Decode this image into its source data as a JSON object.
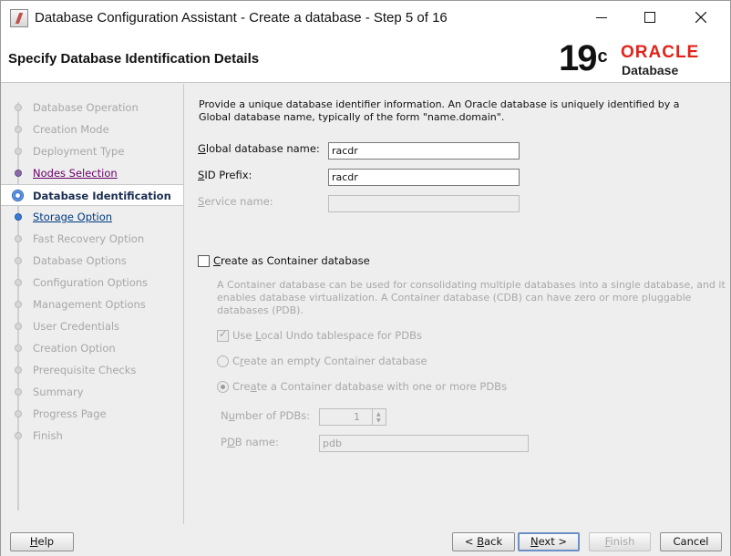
{
  "window": {
    "title": "Database Configuration Assistant - Create a database - Step 5 of 16"
  },
  "header": {
    "page_title": "Specify Database Identification Details",
    "logo_version": "19",
    "logo_version_sup": "c",
    "logo_brand": "ORACLE",
    "logo_product": "Database",
    "brand_color": "#e2231a"
  },
  "nav": {
    "items": [
      {
        "label": "Database Operation",
        "state": "disabled"
      },
      {
        "label": "Creation Mode",
        "state": "disabled"
      },
      {
        "label": "Deployment Type",
        "state": "disabled"
      },
      {
        "label": "Nodes Selection",
        "state": "visited"
      },
      {
        "label": "Database Identification",
        "state": "current"
      },
      {
        "label": "Storage Option",
        "state": "link"
      },
      {
        "label": "Fast Recovery Option",
        "state": "disabled"
      },
      {
        "label": "Database Options",
        "state": "disabled"
      },
      {
        "label": "Configuration Options",
        "state": "disabled"
      },
      {
        "label": "Management Options",
        "state": "disabled"
      },
      {
        "label": "User Credentials",
        "state": "disabled"
      },
      {
        "label": "Creation Option",
        "state": "disabled"
      },
      {
        "label": "Prerequisite Checks",
        "state": "disabled"
      },
      {
        "label": "Summary",
        "state": "disabled"
      },
      {
        "label": "Progress Page",
        "state": "disabled"
      },
      {
        "label": "Finish",
        "state": "disabled"
      }
    ]
  },
  "main": {
    "description": "Provide a unique database identifier information. An Oracle database is uniquely identified by a Global database name, typically of the form \"name.domain\".",
    "global_name": {
      "label_first": "G",
      "label_rest": "lobal database name:",
      "value": "racdr"
    },
    "sid_prefix": {
      "label_first": "S",
      "label_rest": "ID Prefix:",
      "value": "racdr"
    },
    "service_name": {
      "label_first": "S",
      "label_rest": "ervice name:",
      "value": ""
    },
    "container_checkbox": {
      "label_first": "C",
      "label_rest": "reate as Container database",
      "checked": false
    },
    "container_description": "A Container database can be used for consolidating multiple databases into a single database, and it enables database virtualization. A Container database (CDB) can have zero or more pluggable databases (PDB).",
    "local_undo": {
      "label_pre": "Use ",
      "label_ul": "L",
      "label_post": "ocal Undo tablespace for PDBs",
      "checked": true
    },
    "empty_cdb": {
      "label_pre": "C",
      "label_ul": "r",
      "label_post": "eate an empty Container database",
      "checked": false
    },
    "cdb_with_pdbs": {
      "label_pre": "Cre",
      "label_ul": "a",
      "label_post": "te a Container database with one or more PDBs",
      "checked": true
    },
    "num_pdbs": {
      "label_pre": "N",
      "label_ul": "u",
      "label_post": "mber of PDBs:",
      "value": "1"
    },
    "pdb_name": {
      "label_pre": "P",
      "label_ul": "D",
      "label_post": "B name:",
      "value": "pdb"
    }
  },
  "footer": {
    "help": {
      "ul": "H",
      "rest": "elp"
    },
    "back": {
      "pre": "< ",
      "ul": "B",
      "rest": "ack"
    },
    "next": {
      "ul": "N",
      "rest": "ext >"
    },
    "finish": {
      "ul": "F",
      "rest": "inish"
    },
    "cancel": "Cancel"
  }
}
